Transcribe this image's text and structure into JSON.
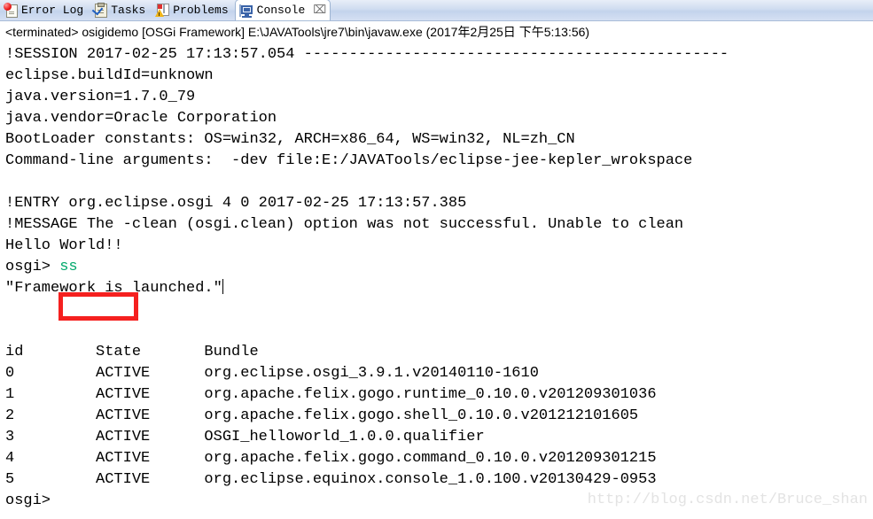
{
  "window": {
    "title": "Eclipse Console View"
  },
  "tabs": [
    {
      "id": "error-log",
      "label": "Error Log",
      "icon": "error-log-icon",
      "active": false,
      "closable": false
    },
    {
      "id": "tasks",
      "label": "Tasks",
      "icon": "tasks-icon",
      "active": false,
      "closable": false
    },
    {
      "id": "problems",
      "label": "Problems",
      "icon": "problems-icon",
      "active": false,
      "closable": false
    },
    {
      "id": "console",
      "label": "Console",
      "icon": "console-icon",
      "active": true,
      "closable": true,
      "close_glyph": "⌧"
    }
  ],
  "process_header": {
    "text": "<terminated> osigidemo [OSGi Framework] E:\\JAVATools\\jre7\\bin\\javaw.exe (2017年2月25日 下午5:13:56)",
    "status": "terminated",
    "launch_name": "osigidemo",
    "launch_type": "OSGi Framework",
    "executable": "E:\\JAVATools\\jre7\\bin\\javaw.exe",
    "timestamp": "2017年2月25日 下午5:13:56"
  },
  "console": {
    "lines": [
      "!SESSION 2017-02-25 17:13:57.054 -----------------------------------------------",
      "eclipse.buildId=unknown",
      "java.version=1.7.0_79",
      "java.vendor=Oracle Corporation",
      "BootLoader constants: OS=win32, ARCH=x86_64, WS=win32, NL=zh_CN",
      "Command-line arguments:  -dev file:E:/JAVATools/eclipse-jee-kepler_wrokspace",
      "",
      "!ENTRY org.eclipse.osgi 4 0 2017-02-25 17:13:57.385",
      "!MESSAGE The -clean (osgi.clean) option was not successful. Unable to clean",
      "Hello World!!"
    ],
    "prompt": "osgi>",
    "command": "ss",
    "command_color": "#00a86b",
    "after_command_lines": [
      "\"Framework is launched.\"",
      "",
      ""
    ],
    "bundle_table": {
      "headers": [
        "id",
        "State",
        "Bundle"
      ],
      "rows": [
        [
          "0",
          "ACTIVE",
          "org.eclipse.osgi_3.9.1.v20140110-1610"
        ],
        [
          "1",
          "ACTIVE",
          "org.apache.felix.gogo.runtime_0.10.0.v201209301036"
        ],
        [
          "2",
          "ACTIVE",
          "org.apache.felix.gogo.shell_0.10.0.v201212101605"
        ],
        [
          "3",
          "ACTIVE",
          "OSGI_helloworld_1.0.0.qualifier"
        ],
        [
          "4",
          "ACTIVE",
          "org.apache.felix.gogo.command_0.10.0.v201209301215"
        ],
        [
          "5",
          "ACTIVE",
          "org.eclipse.equinox.console_1.0.100.v20130429-0953"
        ]
      ]
    },
    "final_prompt": "osgi>"
  },
  "annotation": {
    "type": "rectangle",
    "color": "#f5201f",
    "targets": "ss"
  },
  "watermark": {
    "text": "http://blog.csdn.net/Bruce_shan",
    "color": "#e3e3e3"
  }
}
